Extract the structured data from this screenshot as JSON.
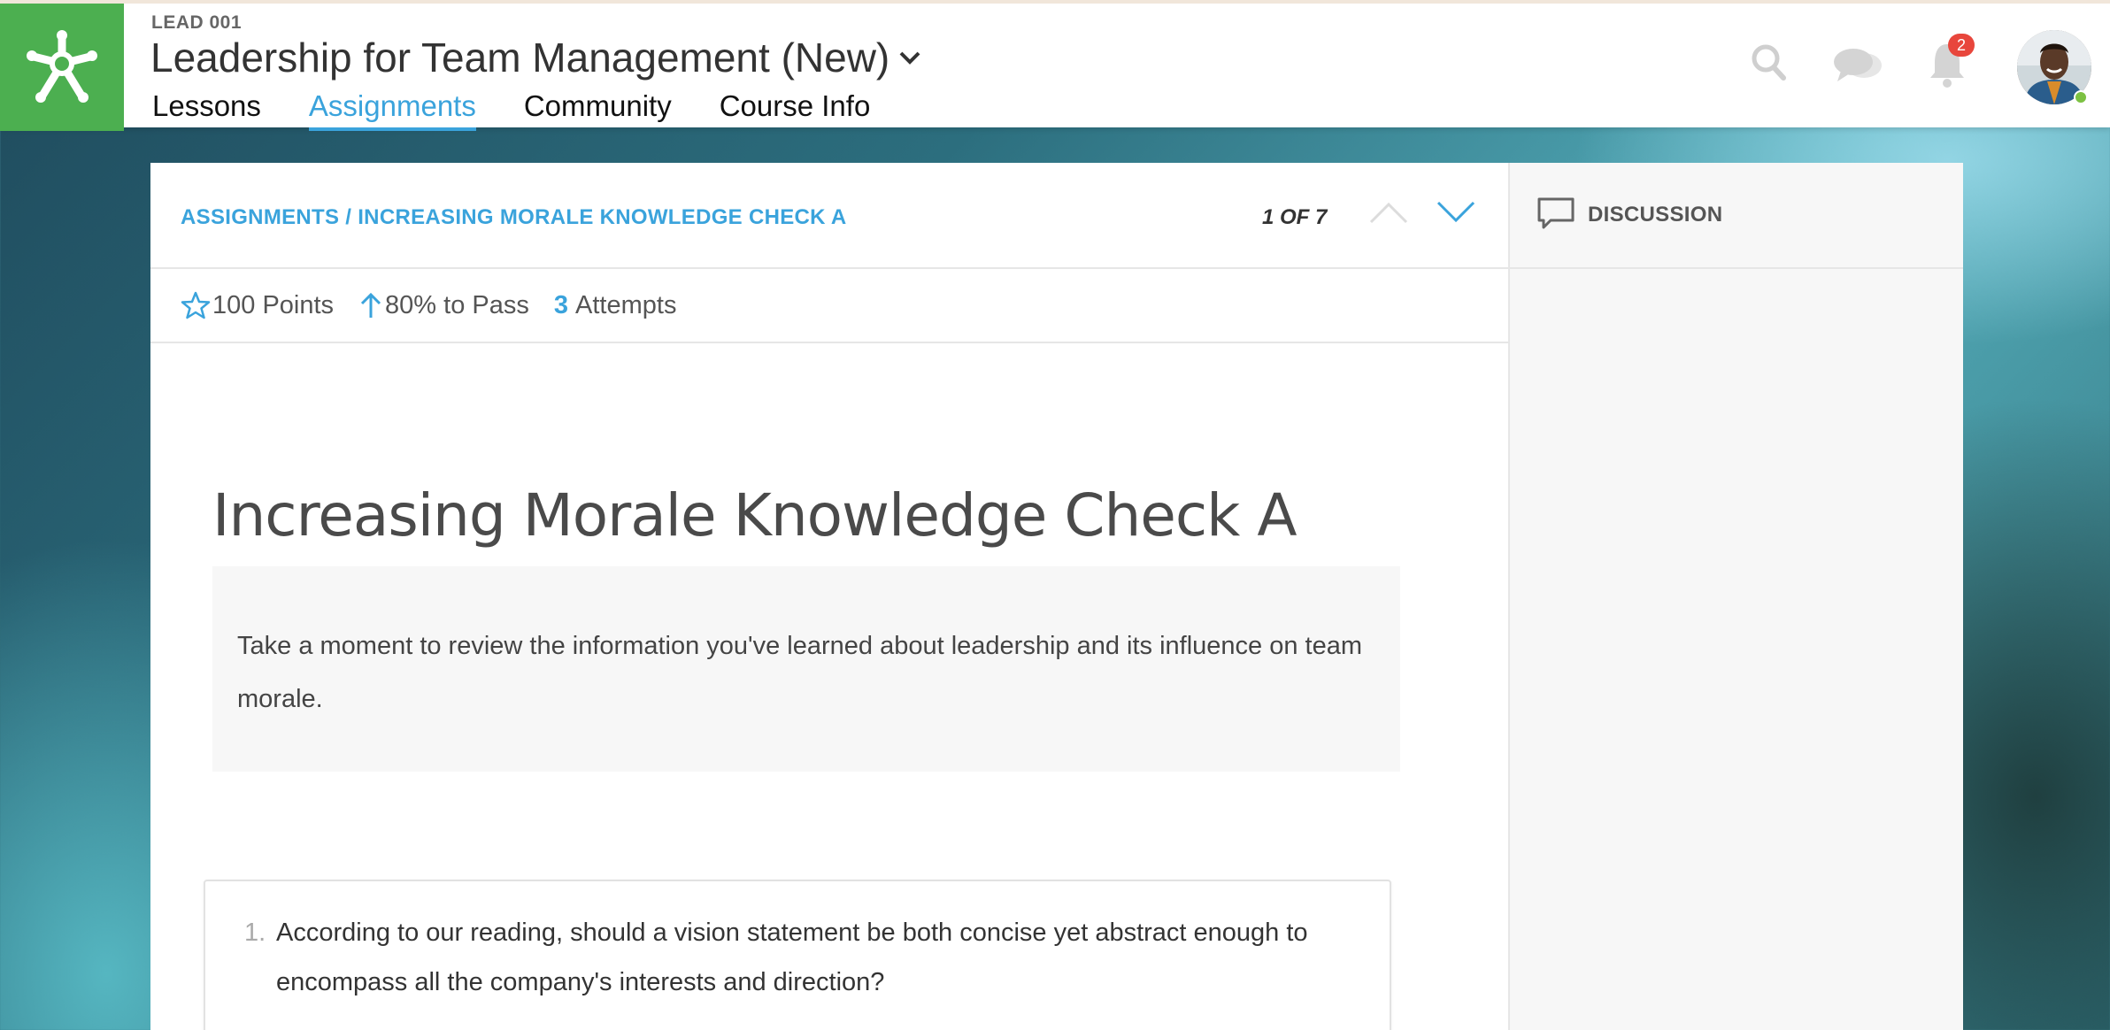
{
  "header": {
    "course_code": "LEAD 001",
    "course_title": "Leadership for Team Management (New)",
    "tabs": [
      {
        "label": "Lessons"
      },
      {
        "label": "Assignments",
        "active": true
      },
      {
        "label": "Community"
      },
      {
        "label": "Course Info"
      }
    ],
    "notification_count": "2",
    "icons": [
      "search-icon",
      "chat-icon",
      "bell-icon"
    ]
  },
  "assignment": {
    "breadcrumb": "ASSIGNMENTS / INCREASING MORALE KNOWLEDGE CHECK A",
    "pager": "1 OF 7",
    "points": "100 Points",
    "pass": "80% to Pass",
    "attempts_count": "3",
    "attempts_label": "Attempts",
    "title": "Increasing Morale Knowledge Check A",
    "instructions": "Take a moment to review the information you've learned about leadership and its influence on team morale.",
    "question_number": "1.",
    "question_text": "According to our reading, should a vision statement be both concise yet abstract enough to encompass all the company's interests and direction?"
  },
  "discussion": {
    "label": "DISCUSSION"
  },
  "colors": {
    "accent": "#3aa3dc",
    "brand_green": "#4caf50",
    "badge_red": "#e8463c",
    "online_green": "#7cc142"
  }
}
